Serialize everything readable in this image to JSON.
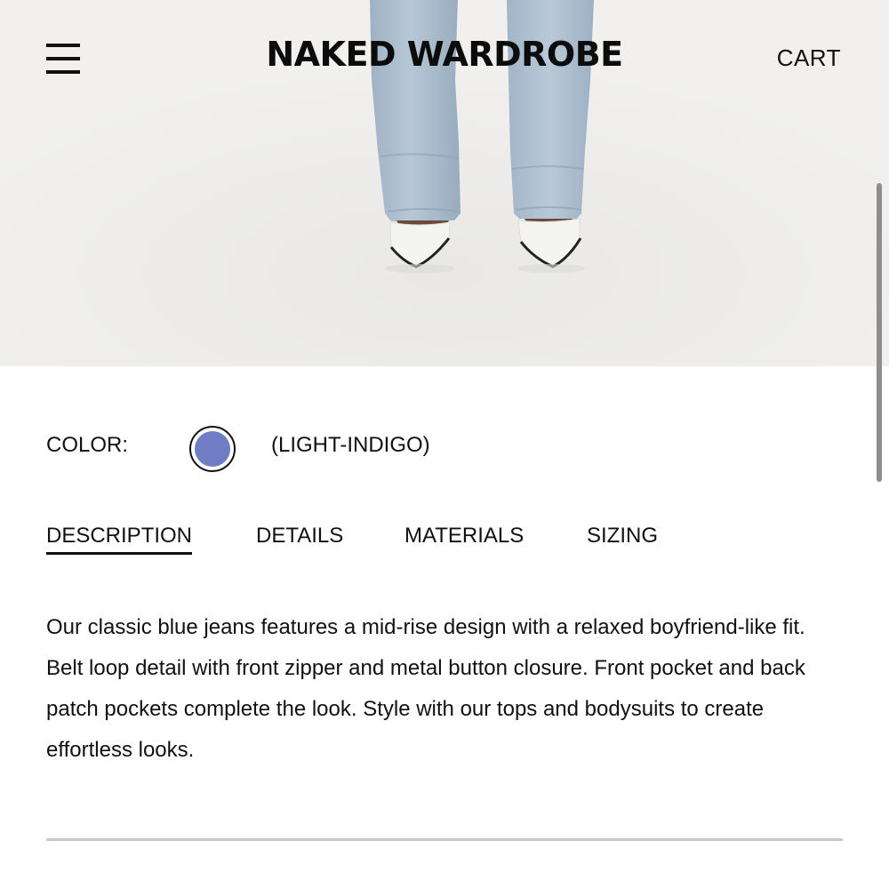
{
  "header": {
    "brand": "NAKED WARDROBE",
    "cart_label": "CART",
    "menu_icon": "hamburger-menu-icon"
  },
  "product": {
    "color_label": "COLOR:",
    "selected_color_name": "(LIGHT-INDIGO)",
    "selected_color_swatch": "#6f7ec4",
    "tabs": [
      {
        "label": "DESCRIPTION",
        "active": true
      },
      {
        "label": "DETAILS",
        "active": false
      },
      {
        "label": "MATERIALS",
        "active": false
      },
      {
        "label": "SIZING",
        "active": false
      }
    ],
    "description": "Our classic blue jeans features a mid-rise design with a relaxed boyfriend-like fit. Belt loop detail with front zipper and metal button closure. Front pocket and back patch pockets complete the look. Style with our tops and bodysuits to create effortless looks."
  },
  "colors": {
    "text": "#111111",
    "divider": "#c9c9c9",
    "denim": "#a9bccd"
  }
}
